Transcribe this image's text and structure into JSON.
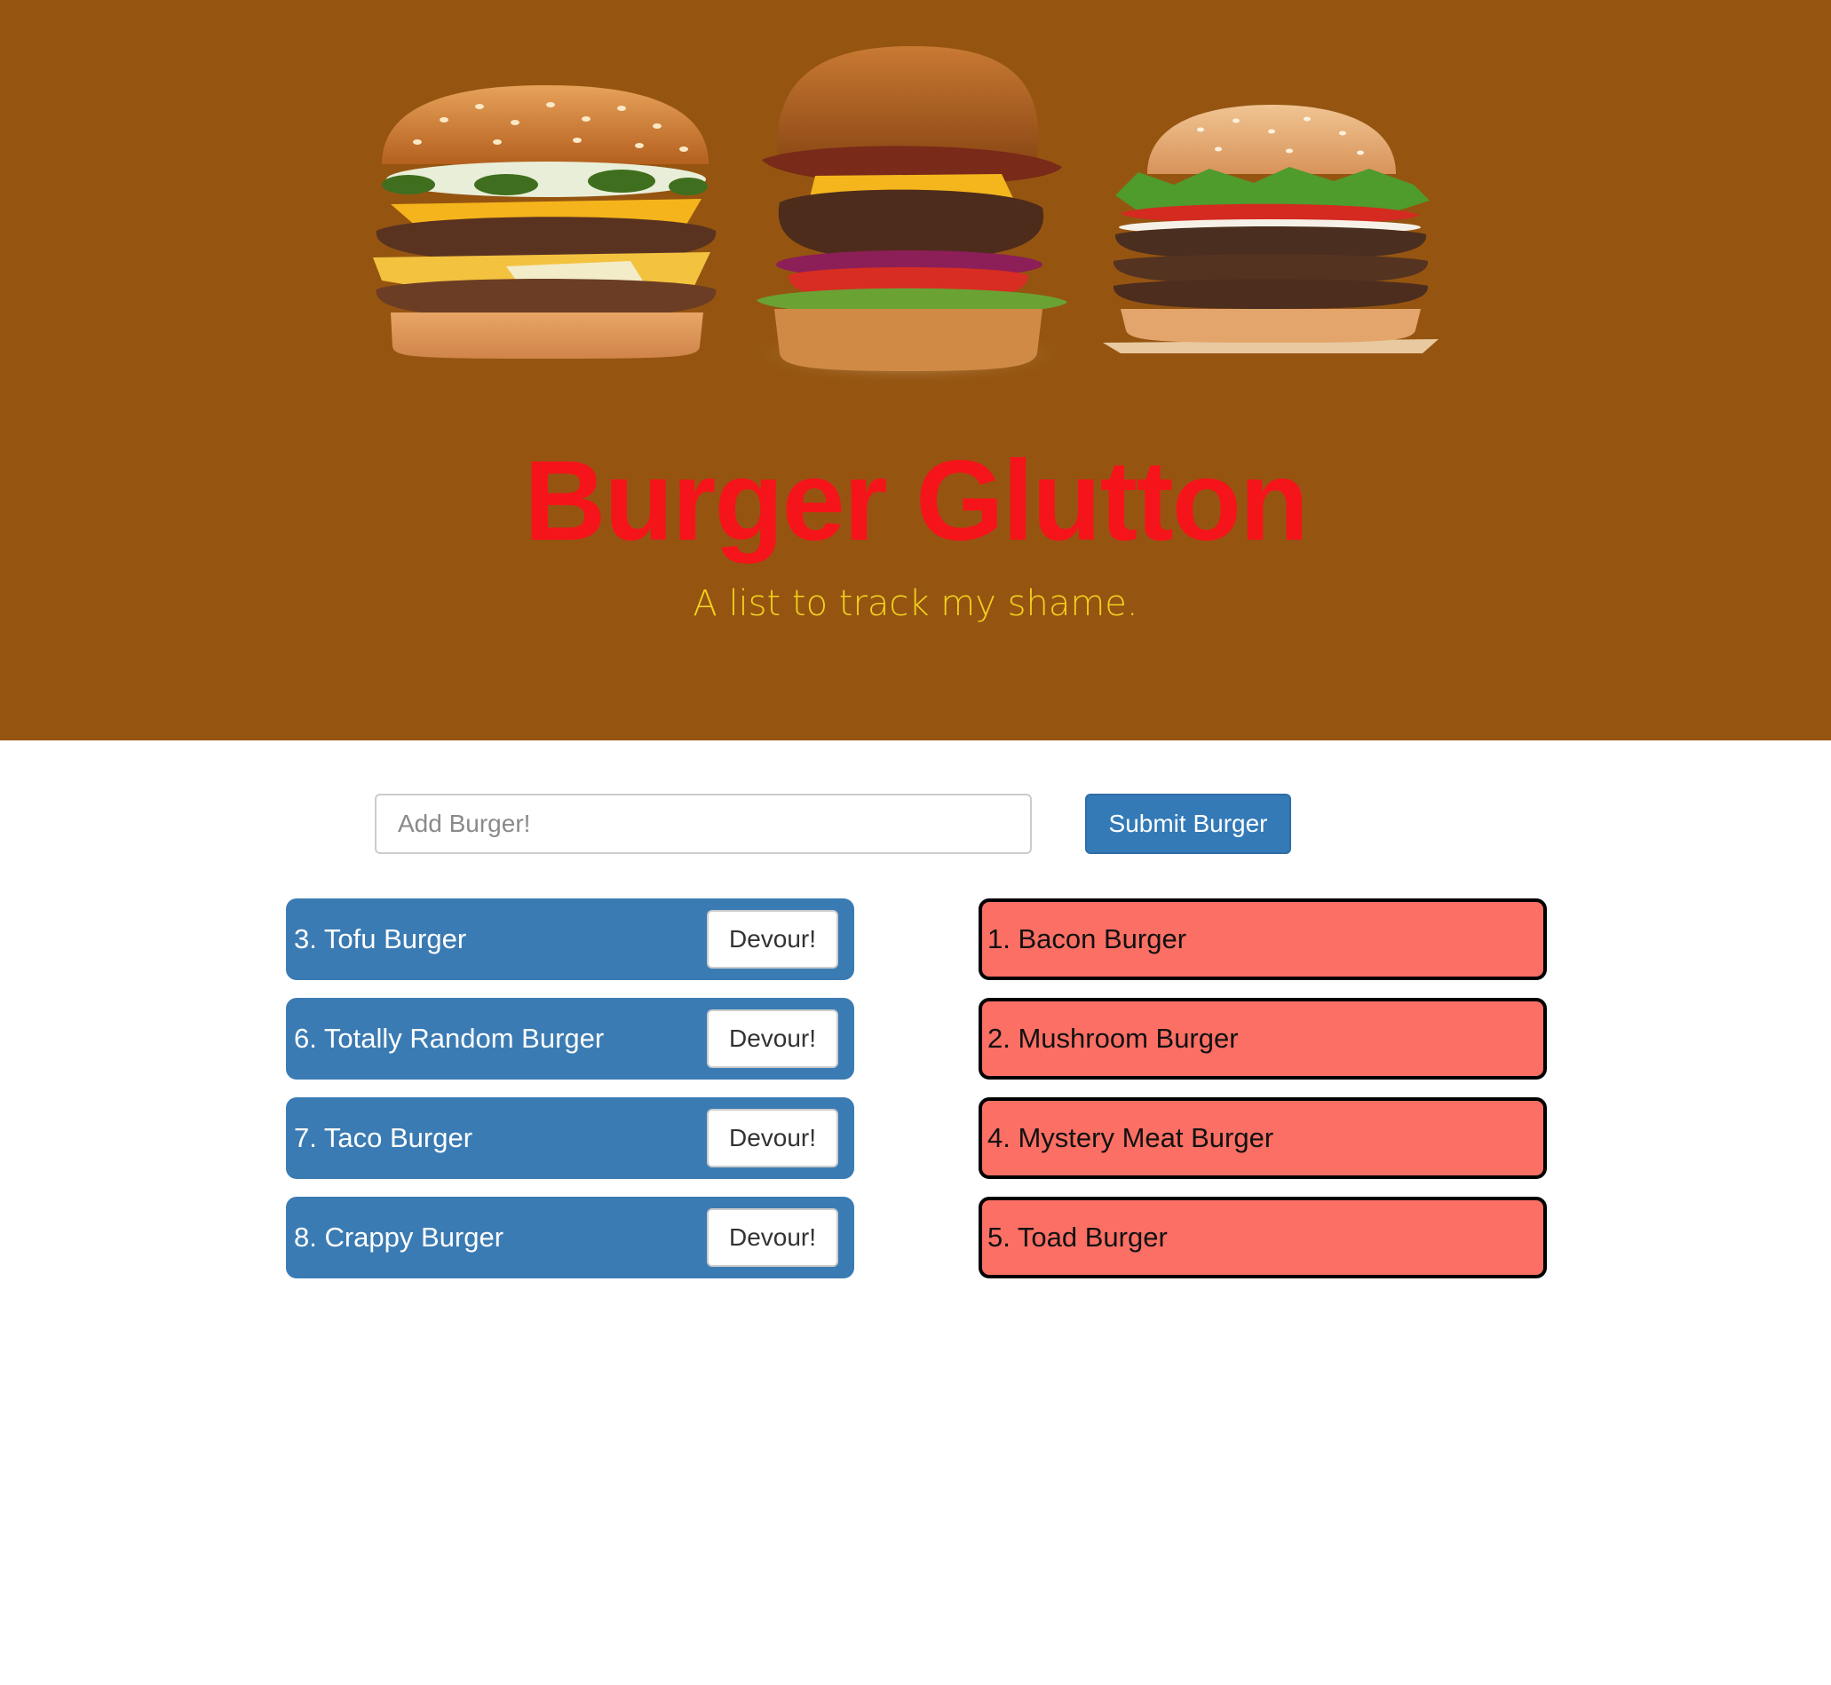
{
  "header": {
    "title": "Burger Glutton",
    "subtitle": "A list to track my shame.",
    "background_color": "#955511",
    "title_color": "#f5141a",
    "subtitle_color": "#f4d11d",
    "images": [
      "burger-image-double-jalapeno",
      "burger-image-bacon-cheeseburger",
      "burger-image-triple-whopper"
    ]
  },
  "form": {
    "placeholder": "Add Burger!",
    "value": "",
    "submit_label": "Submit Burger",
    "accent": "#337ab7"
  },
  "uneaten": {
    "color": "#3b7bb3",
    "button_label": "Devour!",
    "items": [
      {
        "label": "3. Tofu Burger"
      },
      {
        "label": "6. Totally Random Burger"
      },
      {
        "label": "7. Taco Burger"
      },
      {
        "label": "8. Crappy Burger"
      }
    ]
  },
  "devoured": {
    "color": "#fb6f64",
    "items": [
      {
        "label": "1. Bacon Burger"
      },
      {
        "label": "2. Mushroom Burger"
      },
      {
        "label": "4. Mystery Meat Burger"
      },
      {
        "label": "5. Toad Burger"
      }
    ]
  }
}
